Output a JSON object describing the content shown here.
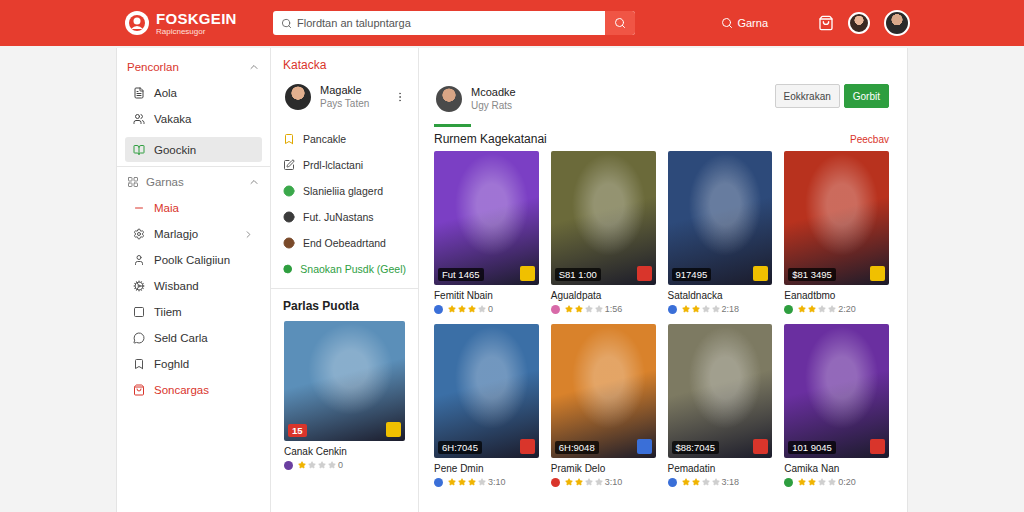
{
  "header": {
    "logo": {
      "name": "FOSKGEIN",
      "tagline": "Rapicnesugor"
    },
    "search": {
      "placeholder": "Flordtan an talupntarga"
    },
    "link": "Garna"
  },
  "sidebar": {
    "sections": [
      {
        "title": "Pencorlan",
        "expanded": true,
        "accent": true,
        "items": [
          {
            "label": "Aola",
            "selected": false,
            "submenu": false,
            "color": "#444444"
          },
          {
            "label": "Vakaka",
            "selected": false,
            "submenu": false,
            "color": "#444444"
          },
          {
            "label": "Goockin",
            "selected": true,
            "submenu": false,
            "color": "#2e9e3f"
          }
        ]
      },
      {
        "title": "Garnas",
        "expanded": true,
        "accent": false,
        "items": [
          {
            "label": "Maia",
            "selected": false,
            "submenu": false,
            "color": "#d9352b"
          },
          {
            "label": "Marlagjo",
            "selected": false,
            "submenu": true,
            "color": "#555555"
          },
          {
            "label": "Poolk Caligiiun",
            "selected": false,
            "submenu": false,
            "color": "#555555"
          },
          {
            "label": "Wisband",
            "selected": false,
            "submenu": false,
            "color": "#555555"
          },
          {
            "label": "Tiiem",
            "selected": false,
            "submenu": false,
            "color": "#555555"
          },
          {
            "label": "Seld Carla",
            "selected": false,
            "submenu": false,
            "color": "#555555"
          },
          {
            "label": "Foghld",
            "selected": false,
            "submenu": false,
            "color": "#555555"
          },
          {
            "label": "Soncargas",
            "selected": false,
            "submenu": false,
            "color": "#d9352b"
          }
        ]
      }
    ]
  },
  "middle": {
    "title": "Katacka",
    "profile": {
      "name": "Magakle",
      "subtitle": "Pays Taten"
    },
    "items": [
      {
        "label": "Pancakle",
        "accent": false,
        "color": "#e0a800"
      },
      {
        "label": "Prdl-lclactani",
        "accent": false,
        "color": "#555555"
      },
      {
        "label": "Slanieliia glagerd",
        "accent": false,
        "color": "#3aa84a"
      },
      {
        "label": "Fut. JuNastans",
        "accent": false,
        "color": "#3b3b3b"
      },
      {
        "label": "End Oebeadrtand",
        "accent": false,
        "color": "#7a4a2a"
      },
      {
        "label": "Snaokan Pusdk (Geel)",
        "accent": true,
        "color": "#2e9e3f"
      }
    ],
    "featured": {
      "title": "Parlas Puotla",
      "card": {
        "title": "Canak Cenkin",
        "price": "15",
        "stars": 1,
        "count": "0",
        "color": "#5b8fb9"
      }
    }
  },
  "content": {
    "profile": {
      "name": "Mcoadke",
      "subtitle": "Ugy Rats"
    },
    "buttons": [
      {
        "label": "Eokkrakan",
        "primary": false
      },
      {
        "label": "Gorbit",
        "primary": true
      }
    ],
    "title": "Rurnem Kagekatanai",
    "link": "Peecbav",
    "games": [
      {
        "title": "Femitit Nbain",
        "price": "Fut 1465",
        "stars": 3,
        "count": "0",
        "color": "#7b3fc4"
      },
      {
        "title": "Agualdpata",
        "price": "S81 1:00",
        "stars": 2,
        "count": "1:56",
        "color": "#6b6a3a"
      },
      {
        "title": "Sataldnacka",
        "price": "917495",
        "stars": 2,
        "count": "2:18",
        "color": "#2d4a7a"
      },
      {
        "title": "Eanadtbmo",
        "price": "$81 3495",
        "stars": 2,
        "count": "2:20",
        "color": "#b8321e"
      },
      {
        "title": "Pene Dmin",
        "price": "6H:7045",
        "stars": 3,
        "count": "3:10",
        "color": "#3b6fa6"
      },
      {
        "title": "Pramik Delo",
        "price": "6H:9048",
        "stars": 2,
        "count": "3:10",
        "color": "#d9822b"
      },
      {
        "title": "Pemadatin",
        "price": "$88:7045",
        "stars": 2,
        "count": "3:18",
        "color": "#7d7a62"
      },
      {
        "title": "Camika Nan",
        "price": "101 9045",
        "stars": 2,
        "count": "0:20",
        "color": "#6a2fa0"
      }
    ]
  }
}
